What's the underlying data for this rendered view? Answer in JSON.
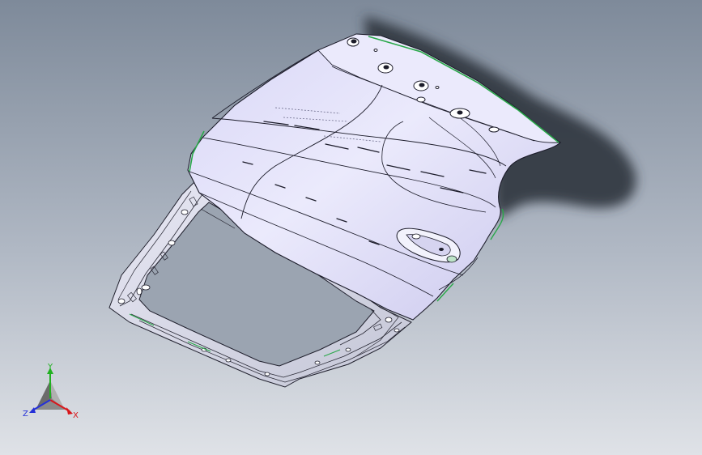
{
  "viewport": {
    "background_top": "#7e8a9a",
    "background_bottom": "#dde1e6",
    "model_shade": "#cfcdee",
    "model_highlight": "#eeeefe",
    "edge_color": "#1c1c2a",
    "weld_color": "#2aa84a"
  },
  "triad": {
    "x_label": "X",
    "y_label": "Y",
    "z_label": "Z",
    "x_color": "#d8161a",
    "y_color": "#20b020",
    "z_color": "#2430d8"
  }
}
